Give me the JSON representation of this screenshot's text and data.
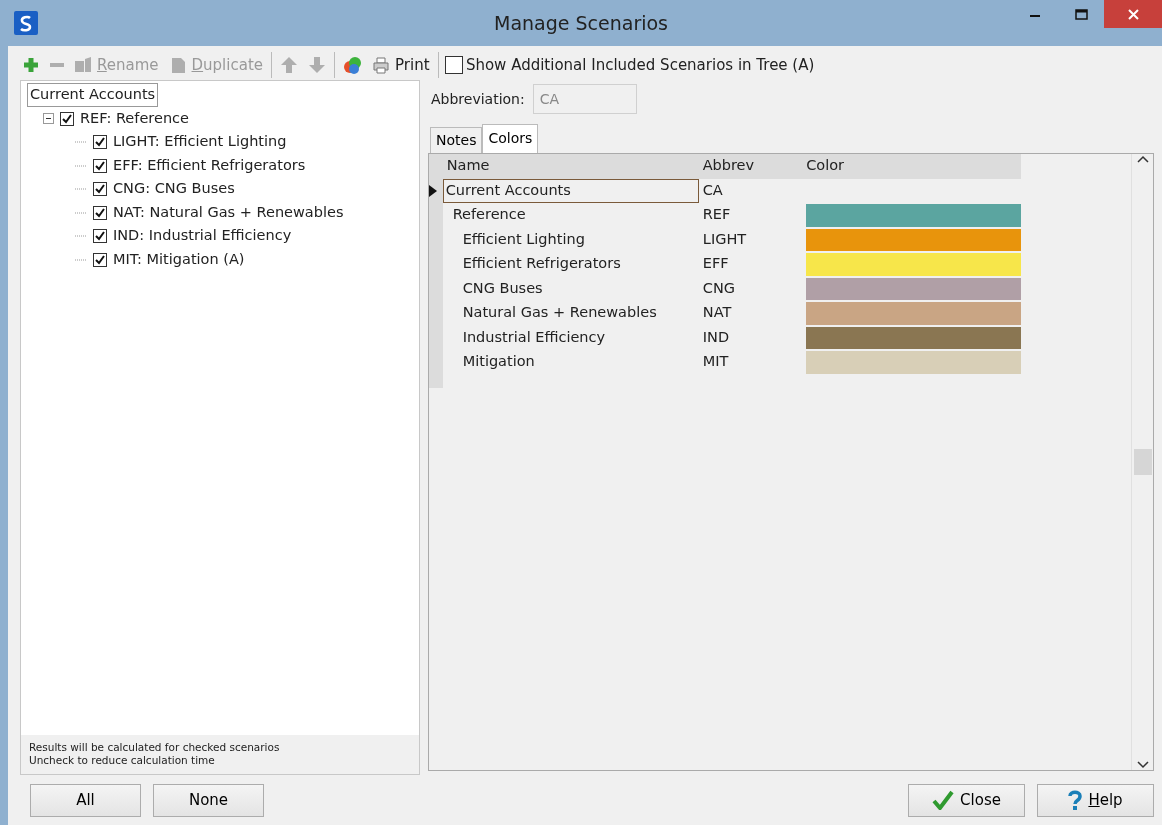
{
  "window": {
    "title": "Manage Scenarios"
  },
  "toolbar": {
    "items": [
      {
        "kind": "add",
        "disabled": false
      },
      {
        "kind": "remove",
        "disabled": true
      },
      {
        "kind": "rename",
        "label": "Rename",
        "disabled": true,
        "mnemonic": true
      },
      {
        "kind": "duplicate",
        "label": "Duplicate",
        "disabled": true,
        "mnemonic": true
      },
      {
        "kind": "separator"
      },
      {
        "kind": "up",
        "disabled": true
      },
      {
        "kind": "down",
        "disabled": true
      },
      {
        "kind": "separator"
      },
      {
        "kind": "colors",
        "disabled": false
      },
      {
        "kind": "print",
        "label": "Print",
        "disabled": false
      },
      {
        "kind": "separator"
      },
      {
        "kind": "checkbox",
        "label": "Show Additional Included Scenarios in Tree (A)",
        "checked": false
      }
    ]
  },
  "tree": {
    "root": "Current Accounts",
    "items": [
      {
        "label": "REF: Reference",
        "checked": true,
        "expanded": true,
        "children": [
          {
            "label": "LIGHT: Efficient Lighting",
            "checked": true
          },
          {
            "label": "EFF: Efficient Refrigerators",
            "checked": true
          },
          {
            "label": "CNG: CNG Buses",
            "checked": true
          },
          {
            "label": "NAT: Natural Gas + Renewables",
            "checked": true
          },
          {
            "label": "IND: Industrial Efficiency",
            "checked": true
          },
          {
            "label": "MIT: Mitigation (A)",
            "checked": true
          }
        ]
      }
    ]
  },
  "hint": [
    "Results will be calculated for checked scenarios",
    "Uncheck to reduce calculation time"
  ],
  "abbreviation": {
    "label": "Abbreviation:",
    "value": "CA"
  },
  "tabs": [
    {
      "label": "Notes",
      "selected": false
    },
    {
      "label": "Colors",
      "selected": true
    }
  ],
  "grid": {
    "columns": [
      "Name",
      "Abbrev",
      "Color"
    ],
    "rows": [
      {
        "name": "Current Accounts",
        "abbrev": "CA",
        "selected": true,
        "children": [
          {
            "name": "Reference",
            "abbrev": "REF",
            "color": "#5ba5a0",
            "selected": false,
            "children": [
              {
                "name": "Efficient Lighting",
                "abbrev": "LIGHT",
                "color": "#e8940c",
                "selected": false
              },
              {
                "name": "Efficient Refrigerators",
                "abbrev": "EFF",
                "color": "#f7e64a",
                "selected": false
              },
              {
                "name": "CNG Buses",
                "abbrev": "CNG",
                "color": "#b09fa6",
                "selected": false
              },
              {
                "name": "Natural Gas + Renewables",
                "abbrev": "NAT",
                "color": "#c9a584",
                "selected": false
              },
              {
                "name": "Industrial Efficiency",
                "abbrev": "IND",
                "color": "#8a7652",
                "selected": false
              },
              {
                "name": "Mitigation",
                "abbrev": "MIT",
                "color": "#d8cfb7",
                "selected": false
              }
            ]
          }
        ]
      }
    ]
  },
  "buttons_left": [
    {
      "kind": "plain",
      "label": "All"
    },
    {
      "kind": "plain",
      "label": "None"
    }
  ],
  "buttons_right": [
    {
      "kind": "close",
      "label": "Close"
    },
    {
      "kind": "help",
      "label": "Help",
      "mnemonic": true
    }
  ]
}
